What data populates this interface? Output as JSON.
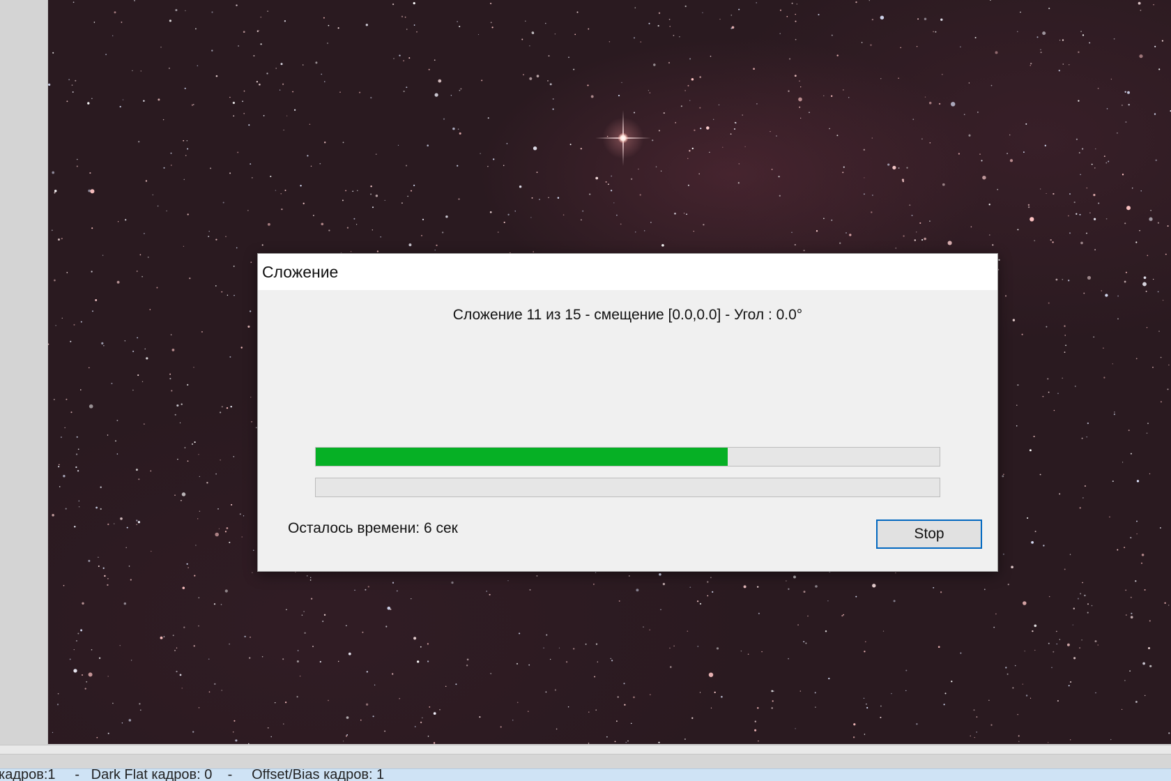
{
  "dialog": {
    "title": "Сложение",
    "status_text": "Сложение 11 из 15 - смещение [0.0,0.0] - Угол : 0.0°",
    "main_progress": 0.66,
    "sub_progress": 0.0,
    "time_left": "Осталось времени: 6 сек",
    "stop_label": "Stop",
    "progress_color": "#06b025"
  },
  "status_bar": {
    "text": "кадров:1     -   Dark Flat кадров: 0    -     Offset/Bias кадров: 1"
  }
}
